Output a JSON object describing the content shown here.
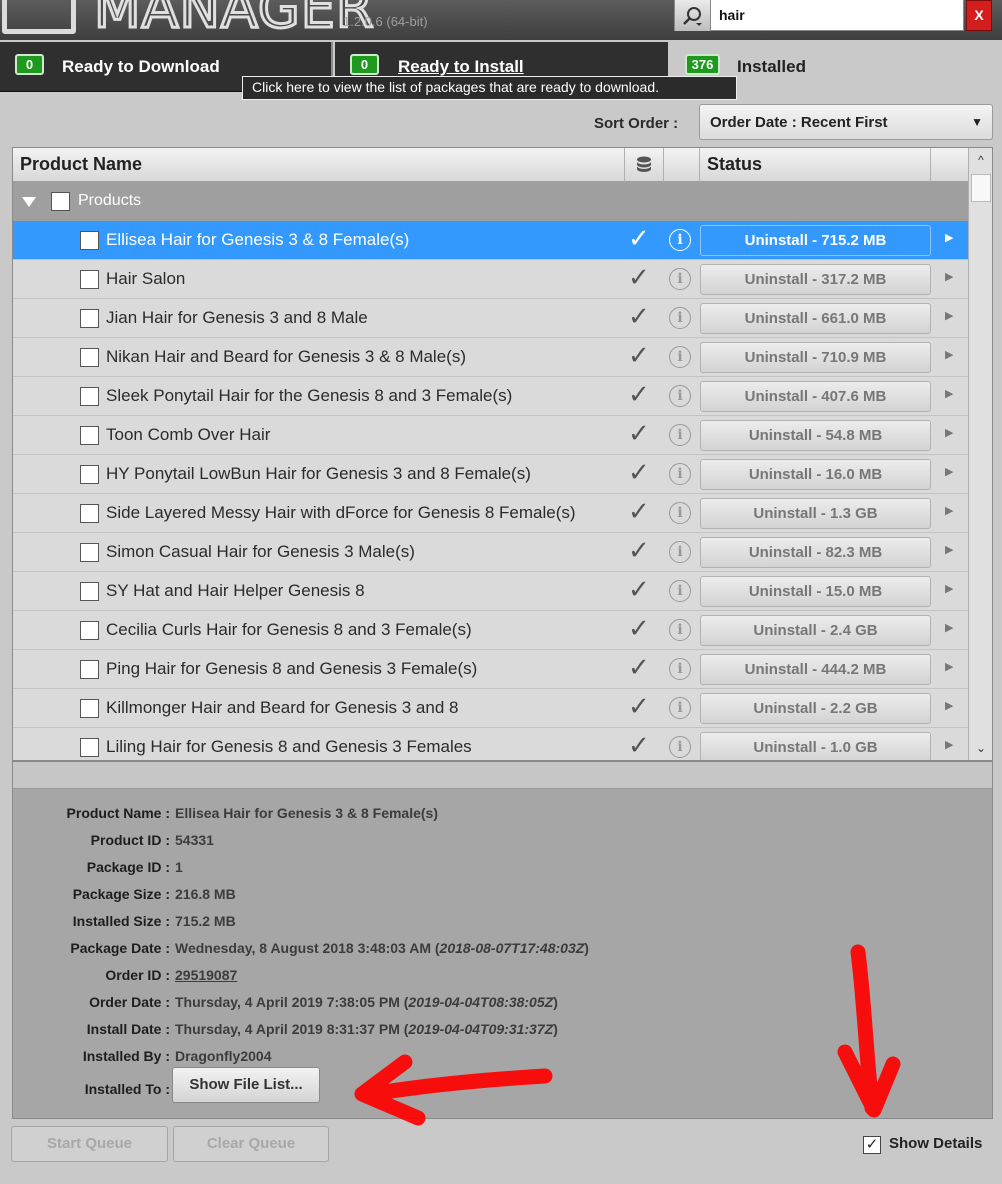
{
  "app": {
    "title": "MANAGER",
    "version": "1.2.0.6 (64-bit)"
  },
  "search": {
    "value": "hair",
    "clear_label": "X"
  },
  "tabs": [
    {
      "count": "0",
      "label": "Ready to Download"
    },
    {
      "count": "0",
      "label": "Ready to Install"
    },
    {
      "count": "376",
      "label": "Installed"
    }
  ],
  "tooltip": "Click here to view the list of packages that are ready to download.",
  "sort": {
    "label": "Sort Order :",
    "value": "Order Date : Recent First"
  },
  "table": {
    "columns": {
      "name": "Product Name",
      "status": "Status"
    },
    "group": "Products",
    "rows": [
      {
        "name": "Ellisea Hair for Genesis 3 & 8 Female(s)",
        "status": "Uninstall - 715.2 MB"
      },
      {
        "name": "Hair Salon",
        "status": "Uninstall - 317.2 MB"
      },
      {
        "name": "Jian Hair for Genesis 3 and 8 Male",
        "status": "Uninstall - 661.0 MB"
      },
      {
        "name": "Nikan Hair and Beard for Genesis 3 & 8 Male(s)",
        "status": "Uninstall - 710.9 MB"
      },
      {
        "name": "Sleek Ponytail Hair for the Genesis 8 and 3 Female(s)",
        "status": "Uninstall - 407.6 MB"
      },
      {
        "name": "Toon Comb Over Hair",
        "status": "Uninstall - 54.8 MB"
      },
      {
        "name": "HY Ponytail LowBun Hair for Genesis 3 and 8 Female(s)",
        "status": "Uninstall - 16.0 MB"
      },
      {
        "name": "Side Layered Messy Hair with dForce for Genesis 8 Female(s)",
        "status": "Uninstall - 1.3 GB"
      },
      {
        "name": "Simon Casual Hair for Genesis 3 Male(s)",
        "status": "Uninstall - 82.3 MB"
      },
      {
        "name": "SY Hat and Hair Helper Genesis 8",
        "status": "Uninstall - 15.0 MB"
      },
      {
        "name": "Cecilia Curls Hair for Genesis 8 and 3 Female(s)",
        "status": "Uninstall - 2.4 GB"
      },
      {
        "name": "Ping Hair for Genesis 8 and Genesis 3 Female(s)",
        "status": "Uninstall - 444.2 MB"
      },
      {
        "name": "Killmonger Hair and Beard for Genesis 3 and 8",
        "status": "Uninstall - 2.2 GB"
      },
      {
        "name": "Liling Hair for Genesis 8 and Genesis 3 Females",
        "status": "Uninstall - 1.0 GB"
      }
    ]
  },
  "details": {
    "product_name": {
      "label": "Product Name :",
      "value": "Ellisea Hair for Genesis 3 & 8 Female(s)"
    },
    "product_id": {
      "label": "Product ID :",
      "value": "54331"
    },
    "package_id": {
      "label": "Package ID :",
      "value": "1"
    },
    "package_size": {
      "label": "Package Size :",
      "value": "216.8 MB"
    },
    "installed_size": {
      "label": "Installed Size :",
      "value": "715.2 MB"
    },
    "package_date": {
      "label": "Package Date :",
      "value": "Wednesday, 8 August 2018 3:48:03 AM (",
      "iso": "2018-08-07T17:48:03Z",
      "close": ")"
    },
    "order_id": {
      "label": "Order ID :",
      "value": "29519087"
    },
    "order_date": {
      "label": "Order Date :",
      "value": "Thursday, 4 April 2019 7:38:05 PM (",
      "iso": "2019-04-04T08:38:05Z",
      "close": ")"
    },
    "install_date": {
      "label": "Install Date :",
      "value": "Thursday, 4 April 2019 8:31:37 PM (",
      "iso": "2019-04-04T09:31:37Z",
      "close": ")"
    },
    "installed_by": {
      "label": "Installed By :",
      "value": "Dragonfly2004"
    },
    "installed_to": {
      "label": "Installed To :",
      "button": "Show File List..."
    }
  },
  "bottom": {
    "start_queue": "Start Queue",
    "clear_queue": "Clear Queue",
    "show_details": "Show Details",
    "show_details_check": "✓"
  },
  "colors": {
    "selection": "#3399ff",
    "badge": "#1f9a1f",
    "annotation": "#ff0000"
  }
}
